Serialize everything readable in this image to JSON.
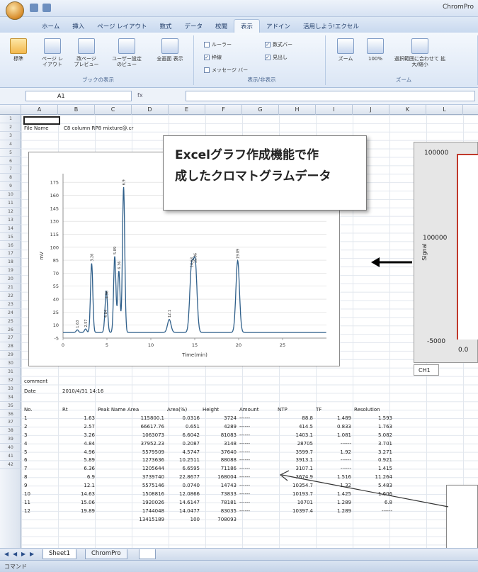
{
  "app": {
    "title": "ChromPro"
  },
  "ribbon_tabs": [
    "ホーム",
    "挿入",
    "ページ レイアウト",
    "数式",
    "データ",
    "校閲",
    "表示",
    "アドイン",
    "活用しよう!エクセル"
  ],
  "active_tab": "表示",
  "ribbon": {
    "views_group": {
      "buttons": [
        "標準",
        "ページ レイアウト",
        "改ページ プレビュー",
        "ユーザー設定 のビュー",
        "全画面 表示"
      ],
      "caption": "ブックの表示"
    },
    "show_group": {
      "checkboxes": [
        {
          "label": "ルーラー",
          "checked": false
        },
        {
          "label": "数式バー",
          "checked": true
        },
        {
          "label": "枠線",
          "checked": true
        },
        {
          "label": "見出し",
          "checked": true
        },
        {
          "label": "メッセージ バー",
          "checked": false
        }
      ],
      "caption": "表示/非表示"
    },
    "zoom_group": {
      "buttons": [
        "ズーム",
        "100%",
        "選択範囲に合わせて 拡大/縮小"
      ],
      "caption": "ズーム"
    }
  },
  "formula_bar": {
    "name_box": "A1",
    "fx": "fx",
    "value": ""
  },
  "columns": [
    "A",
    "B",
    "C",
    "D",
    "E",
    "F",
    "G",
    "H",
    "I",
    "J",
    "K",
    "L"
  ],
  "rows": [
    "1",
    "2",
    "3",
    "4",
    "5",
    "6",
    "7",
    "8",
    "9",
    "10",
    "11",
    "12",
    "13",
    "14",
    "15",
    "16",
    "17",
    "18",
    "19",
    "20",
    "21",
    "22",
    "23",
    "24",
    "25",
    "26",
    "27",
    "28",
    "29",
    "30",
    "31",
    "32",
    "33",
    "34",
    "35",
    "36",
    "37",
    "38",
    "39",
    "40",
    "41",
    "42"
  ],
  "file_line": {
    "label": "File Name",
    "value": "C8 column RP8 mixture@.cr"
  },
  "callout": {
    "line1": "Excelグラフ作成機能で作",
    "line2": "成したクロマトグラムデータ"
  },
  "chart_data": {
    "type": "line",
    "xlabel": "Time(min)",
    "ylabel": "mV",
    "xlim": [
      0,
      30
    ],
    "ylim": [
      -5,
      185
    ],
    "xticks": [
      "0",
      "5",
      "10",
      "15",
      "20",
      "25"
    ],
    "yticks": [
      "-5",
      "10",
      "25",
      "40",
      "55",
      "70",
      "85",
      "100",
      "115",
      "130",
      "145",
      "160",
      "175"
    ],
    "peaks": [
      {
        "rt": 1.63,
        "height": 3
      },
      {
        "rt": 2.57,
        "height": 4
      },
      {
        "rt": 3.26,
        "height": 80
      },
      {
        "rt": 4.84,
        "height": 15
      },
      {
        "rt": 4.96,
        "height": 37
      },
      {
        "rt": 5.89,
        "height": 88
      },
      {
        "rt": 6.36,
        "height": 71
      },
      {
        "rt": 6.9,
        "height": 168
      },
      {
        "rt": 12.1,
        "height": 15
      },
      {
        "rt": 14.63,
        "height": 73
      },
      {
        "rt": 15.06,
        "height": 78
      },
      {
        "rt": 19.89,
        "height": 83
      }
    ],
    "series_color": "#2f5f8a"
  },
  "right_chart": {
    "ticks": [
      "100000",
      "100000",
      "-5000"
    ],
    "xtick": "0.0",
    "ylabel": "Signal",
    "tab": "CH1"
  },
  "comment_label": "comment",
  "date": {
    "label": "Date",
    "value": "2010/4/31 14:16"
  },
  "table": {
    "headers": [
      "No.",
      "Rt",
      "Peak Name",
      "Area",
      "Area(%)",
      "Height",
      "Amount",
      "NTP",
      "TF",
      "Resolution"
    ],
    "rows": [
      [
        "1",
        "1.63",
        "",
        "115800.1",
        "0.0316",
        "3724",
        "------",
        "88.8",
        "1.489",
        "1.593"
      ],
      [
        "2",
        "2.57",
        "",
        "66617.76",
        "0.651",
        "4289",
        "------",
        "414.5",
        "0.833",
        "1.763"
      ],
      [
        "3",
        "3.26",
        "",
        "1063073",
        "6.6042",
        "81083",
        "------",
        "1403.1",
        "1.081",
        "5.082"
      ],
      [
        "4",
        "4.84",
        "",
        "37952.23",
        "0.2087",
        "3148",
        "------",
        "28705",
        "------",
        "3.701"
      ],
      [
        "5",
        "4.96",
        "",
        "5579509",
        "4.5747",
        "37640",
        "------",
        "3599.7",
        "1.92",
        "3.271"
      ],
      [
        "6",
        "5.89",
        "",
        "1273636",
        "10.2511",
        "88088",
        "------",
        "3913.1",
        "------",
        "0.921"
      ],
      [
        "7",
        "6.36",
        "",
        "1205644",
        "6.6595",
        "71186",
        "------",
        "3107.1",
        "------",
        "1.415"
      ],
      [
        "8",
        "6.9",
        "",
        "3739740",
        "22.8677",
        "168004",
        "------",
        "3674.9",
        "1.516",
        "11.264"
      ],
      [
        "9",
        "12.1",
        "",
        "5575146",
        "0.0740",
        "14743",
        "------",
        "10354.7",
        "1.32",
        "5.483"
      ],
      [
        "10",
        "14.63",
        "",
        "1508816",
        "12.0866",
        "73833",
        "------",
        "10193.7",
        "1.425",
        "1.606"
      ],
      [
        "11",
        "15.06",
        "",
        "1920026",
        "14.6147",
        "78181",
        "------",
        "10701",
        "1.289",
        "6.8"
      ],
      [
        "12",
        "19.89",
        "",
        "1744048",
        "14.0477",
        "83035",
        "------",
        "10397.4",
        "1.289",
        "------"
      ]
    ],
    "total": [
      "",
      "",
      "",
      "13415189",
      "100",
      "708093",
      "",
      "",
      "",
      ""
    ]
  },
  "sheet_tabs": [
    "Sheet1",
    "ChromPro"
  ],
  "status": "コマンド"
}
